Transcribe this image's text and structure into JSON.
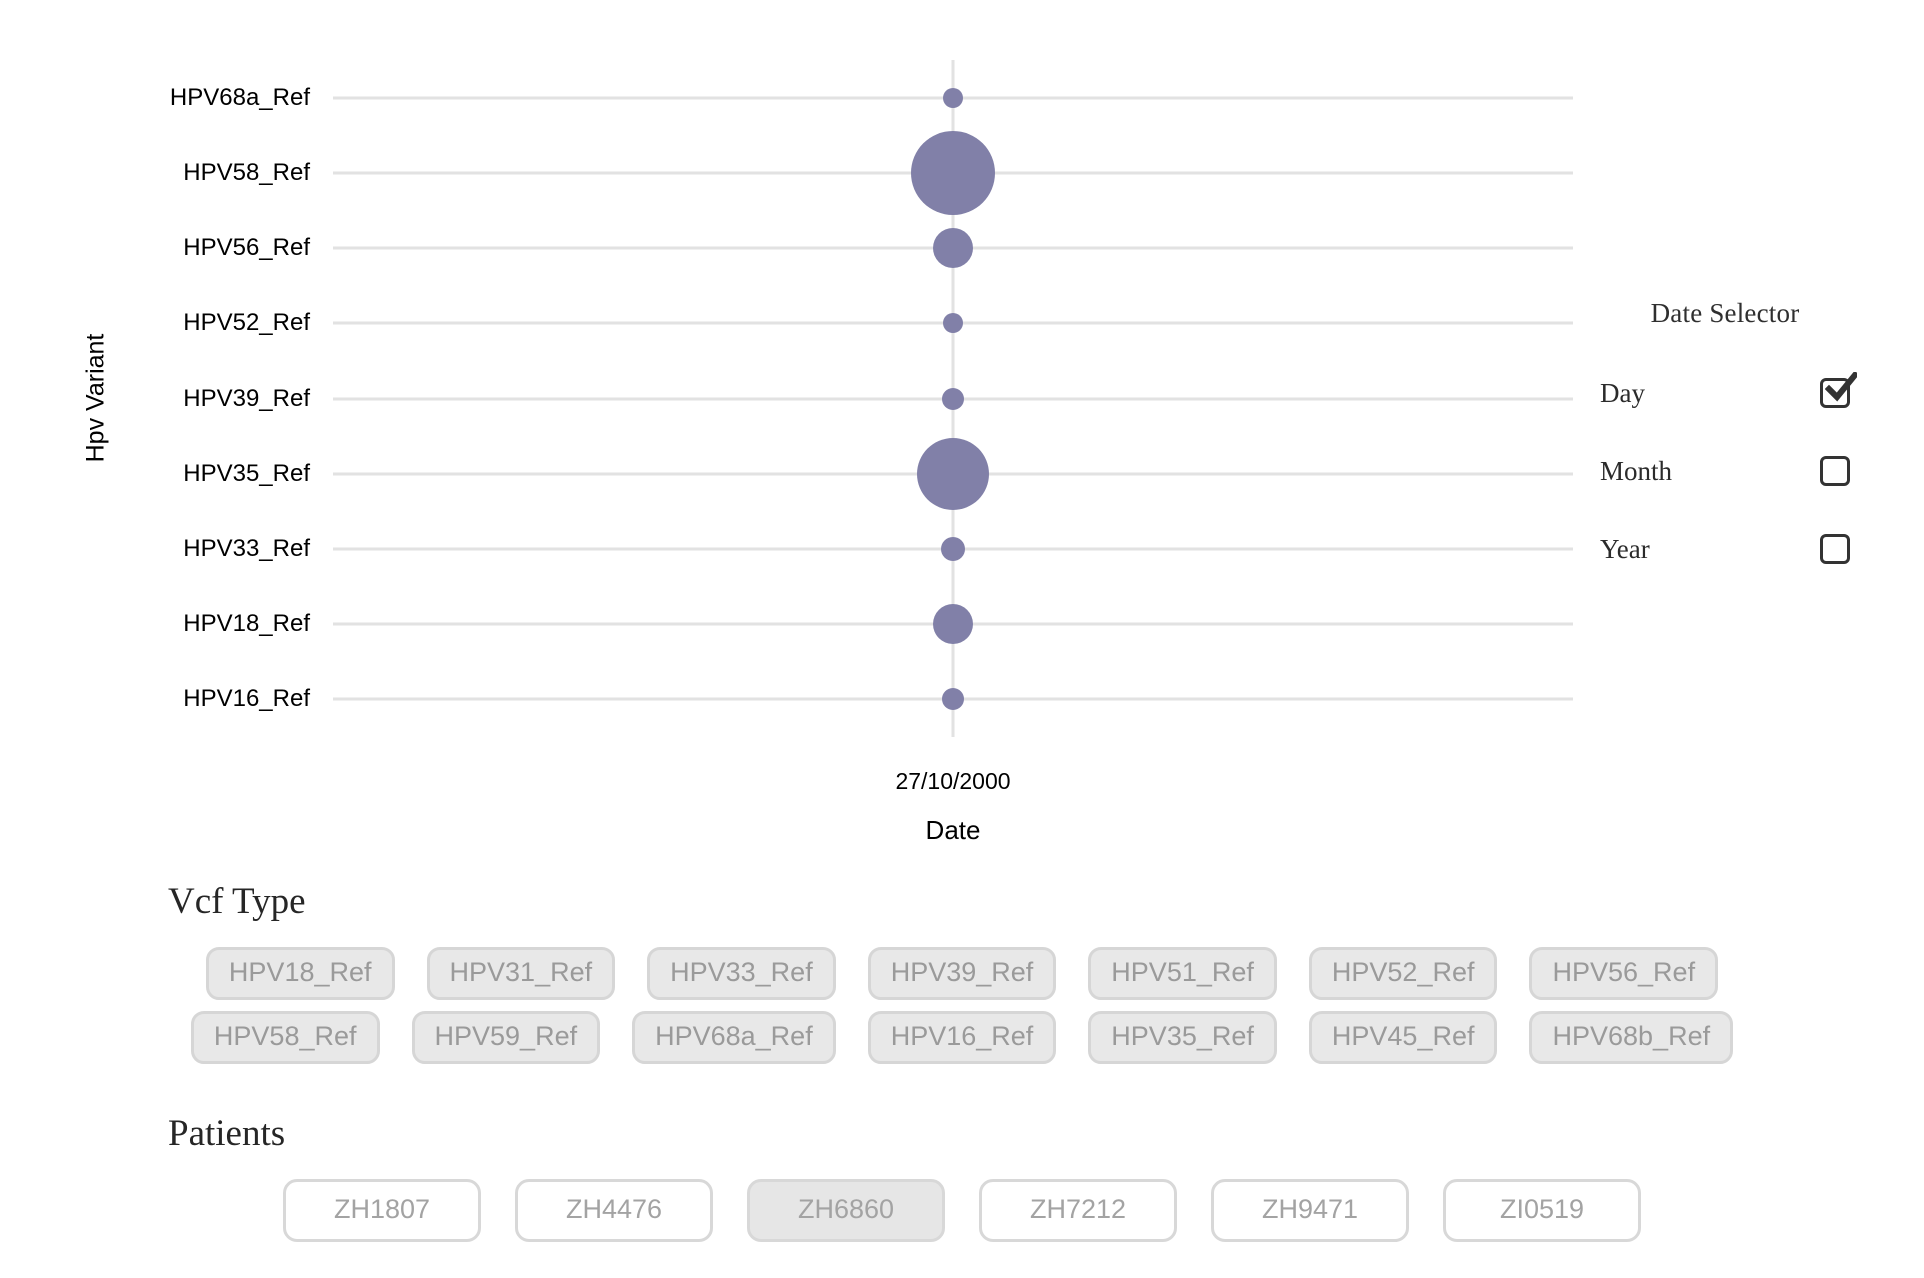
{
  "chart_data": {
    "type": "scatter",
    "title": "",
    "xlabel": "Date",
    "ylabel": "Hpv Variant",
    "x_tick_labels": [
      "27/10/2000"
    ],
    "categories": [
      "HPV68a_Ref",
      "HPV58_Ref",
      "HPV56_Ref",
      "HPV52_Ref",
      "HPV39_Ref",
      "HPV35_Ref",
      "HPV33_Ref",
      "HPV18_Ref",
      "HPV16_Ref"
    ],
    "point_color": "#8180a8",
    "grid": true,
    "points": [
      {
        "y": "HPV68a_Ref",
        "x": "27/10/2000",
        "size": 10
      },
      {
        "y": "HPV58_Ref",
        "x": "27/10/2000",
        "size": 42
      },
      {
        "y": "HPV56_Ref",
        "x": "27/10/2000",
        "size": 20
      },
      {
        "y": "HPV52_Ref",
        "x": "27/10/2000",
        "size": 10
      },
      {
        "y": "HPV39_Ref",
        "x": "27/10/2000",
        "size": 11
      },
      {
        "y": "HPV35_Ref",
        "x": "27/10/2000",
        "size": 36
      },
      {
        "y": "HPV33_Ref",
        "x": "27/10/2000",
        "size": 12
      },
      {
        "y": "HPV18_Ref",
        "x": "27/10/2000",
        "size": 20
      },
      {
        "y": "HPV16_Ref",
        "x": "27/10/2000",
        "size": 11
      }
    ]
  },
  "date_selector": {
    "title": "Date Selector",
    "options": [
      {
        "label": "Day",
        "checked": true
      },
      {
        "label": "Month",
        "checked": false
      },
      {
        "label": "Year",
        "checked": false
      }
    ]
  },
  "vcf_type": {
    "title": "Vcf Type",
    "rows": [
      [
        "HPV18_Ref",
        "HPV31_Ref",
        "HPV33_Ref",
        "HPV39_Ref",
        "HPV51_Ref",
        "HPV52_Ref",
        "HPV56_Ref"
      ],
      [
        "HPV58_Ref",
        "HPV59_Ref",
        "HPV68a_Ref",
        "HPV16_Ref",
        "HPV35_Ref",
        "HPV45_Ref",
        "HPV68b_Ref"
      ]
    ]
  },
  "patients": {
    "title": "Patients",
    "items": [
      {
        "label": "ZH1807",
        "selected": false
      },
      {
        "label": "ZH4476",
        "selected": false
      },
      {
        "label": "ZH6860",
        "selected": true
      },
      {
        "label": "ZH7212",
        "selected": false
      },
      {
        "label": "ZH9471",
        "selected": false
      },
      {
        "label": "ZI0519",
        "selected": false
      }
    ]
  }
}
